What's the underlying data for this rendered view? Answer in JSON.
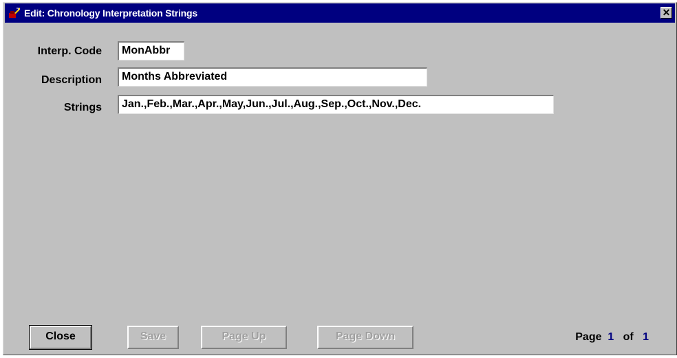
{
  "window": {
    "title": "Edit: Chronology Interpretation Strings"
  },
  "form": {
    "interp_code": {
      "label": "Interp. Code",
      "value": "MonAbbr"
    },
    "description": {
      "label": "Description",
      "value": "Months Abbreviated"
    },
    "strings": {
      "label": "Strings",
      "value": "Jan.,Feb.,Mar.,Apr.,May,Jun.,Jul.,Aug.,Sep.,Oct.,Nov.,Dec."
    }
  },
  "buttons": {
    "close": "Close",
    "save": "Save",
    "page_up": "Page Up",
    "page_down": "Page Down"
  },
  "pager": {
    "label": "Page",
    "current": "1",
    "of": "of",
    "total": "1"
  }
}
